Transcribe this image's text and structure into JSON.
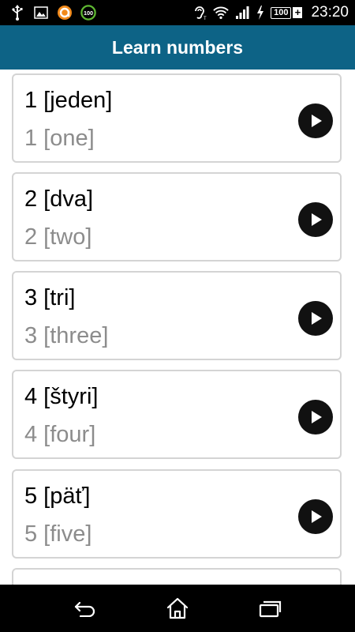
{
  "status_bar": {
    "time": "23:20",
    "battery": "100",
    "badge": "100",
    "icons_left": [
      "usb-icon",
      "image-icon",
      "avast-icon",
      "badge-100-icon"
    ],
    "icons_right": [
      "hearing-aid-icon",
      "wifi-icon",
      "signal-icon",
      "charging-icon",
      "battery-icon"
    ]
  },
  "app_bar": {
    "title": "Learn numbers",
    "color": "#0d6386"
  },
  "items": [
    {
      "native": "1 [jeden]",
      "english": "1 [one]"
    },
    {
      "native": "2 [dva]",
      "english": "2 [two]"
    },
    {
      "native": "3 [tri]",
      "english": "3 [three]"
    },
    {
      "native": "4 [štyri]",
      "english": "4 [four]"
    },
    {
      "native": "5 [päť]",
      "english": "5 [five]"
    }
  ],
  "nav_bar": {
    "buttons": [
      "back-icon",
      "home-icon",
      "recent-apps-icon"
    ]
  }
}
